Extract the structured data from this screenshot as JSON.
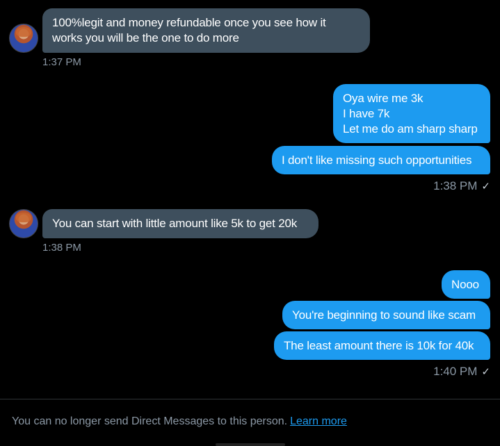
{
  "messages": {
    "m1": {
      "text": "100%legit and money refundable once you see how it\nworks you will be the one to do more",
      "time": "1:37 PM"
    },
    "m2": {
      "text": "Oya wire me 3k\nI have 7k\nLet me do am sharp sharp"
    },
    "m3": {
      "text": "I don't like missing such opportunities",
      "time": "1:38 PM"
    },
    "m4": {
      "text": "You can start with little amount like 5k to get 20k",
      "time": "1:38 PM"
    },
    "m5": {
      "text": "Nooo"
    },
    "m6": {
      "text": "You're beginning to sound like scam"
    },
    "m7": {
      "text": "The least amount there is 10k for 40k",
      "time": "1:40 PM"
    }
  },
  "read_receipt": "✓",
  "footer": {
    "notice": "You can no longer send Direct Messages to this person.",
    "link": "Learn more"
  },
  "colors": {
    "incoming_bubble": "#3e4f5d",
    "outgoing_bubble": "#1d9bf0",
    "background": "#000000"
  }
}
